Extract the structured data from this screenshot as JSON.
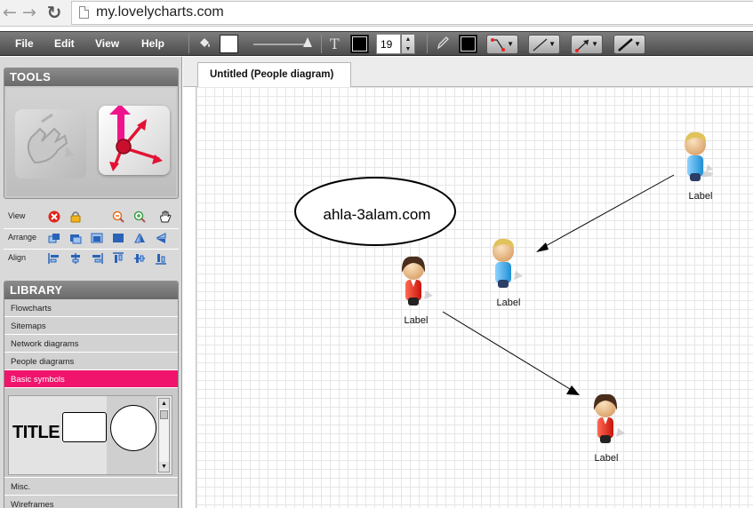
{
  "browser": {
    "url": "my.lovelycharts.com",
    "back_icon": "back-arrow-icon",
    "forward_icon": "forward-arrow-icon",
    "reload_icon": "reload-icon"
  },
  "menu": {
    "file": "File",
    "edit": "Edit",
    "view": "View",
    "help": "Help"
  },
  "toolbar": {
    "font_size": "19",
    "fill_color": "#ffffff",
    "text_color": "#000000",
    "line_color": "#000000"
  },
  "tools": {
    "title": "TOOLS"
  },
  "tool_rows": {
    "view": "View",
    "arrange": "Arrange",
    "align": "Align"
  },
  "library": {
    "title": "LIBRARY",
    "items": [
      "Flowcharts",
      "Sitemaps",
      "Network diagrams",
      "People diagrams",
      "Basic symbols"
    ],
    "active_item": "Basic symbols",
    "preview_title": "TITLE",
    "bottom_items": [
      "Misc.",
      "Wireframes"
    ]
  },
  "document": {
    "tab_title": "Untitled (People diagram)"
  },
  "diagram": {
    "ellipse_text": "ahla-3alam.com",
    "person_labels": [
      "Label",
      "Label",
      "Label",
      "Label"
    ]
  },
  "colors": {
    "accent": "#f0146d",
    "toolbar_dark": "#4b4b4b"
  }
}
